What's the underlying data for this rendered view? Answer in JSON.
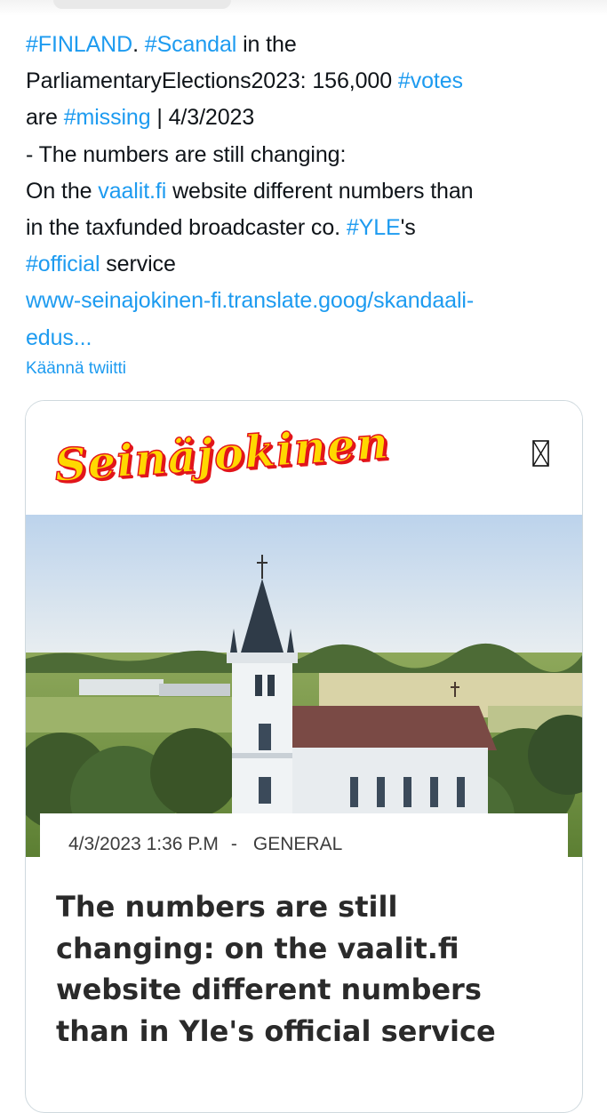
{
  "tweet": {
    "lines": [
      [
        {
          "t": "#FINLAND",
          "link": true
        },
        {
          "t": ". ",
          "link": false
        },
        {
          "t": "#Scandal",
          "link": true
        },
        {
          "t": " in the",
          "link": false
        }
      ],
      [
        {
          "t": "ParliamentaryElections2023: 156,000 ",
          "link": false
        },
        {
          "t": "#votes",
          "link": true
        }
      ],
      [
        {
          "t": "are ",
          "link": false
        },
        {
          "t": "#missing",
          "link": true
        },
        {
          "t": " | 4/3/2023",
          "link": false
        }
      ],
      [
        {
          "t": "- The numbers are still changing:",
          "link": false
        }
      ],
      [
        {
          "t": "On the ",
          "link": false
        },
        {
          "t": "vaalit.fi",
          "link": true
        },
        {
          "t": " website different numbers than",
          "link": false
        }
      ],
      [
        {
          "t": "in the taxfunded broadcaster co. ",
          "link": false
        },
        {
          "t": "#YLE",
          "link": true
        },
        {
          "t": "'s",
          "link": false
        }
      ],
      [
        {
          "t": "#official",
          "link": true
        },
        {
          "t": " service",
          "link": false
        }
      ],
      [
        {
          "t": "www-seinajokinen-fi.translate.goog/skandaali-",
          "link": true
        }
      ],
      [
        {
          "t": "edus...",
          "link": true
        }
      ]
    ],
    "translate_label": "Käännä twiitti"
  },
  "card": {
    "site_name": "Seinäjokinen",
    "icons": {
      "menu": "menu-box-icon"
    },
    "meta": {
      "date": "4/3/2023 1:36 P.M",
      "separator": "-",
      "category": "GENERAL"
    },
    "headline_lines": [
      "The numbers are still",
      "changing: on the vaalit.fi",
      "website different numbers",
      "than in Yle's official service"
    ]
  },
  "colors": {
    "link": "#1d9bf0",
    "logo_fill": "#ffd800",
    "logo_outline": "#e2151b",
    "card_border": "#cfd9de"
  }
}
